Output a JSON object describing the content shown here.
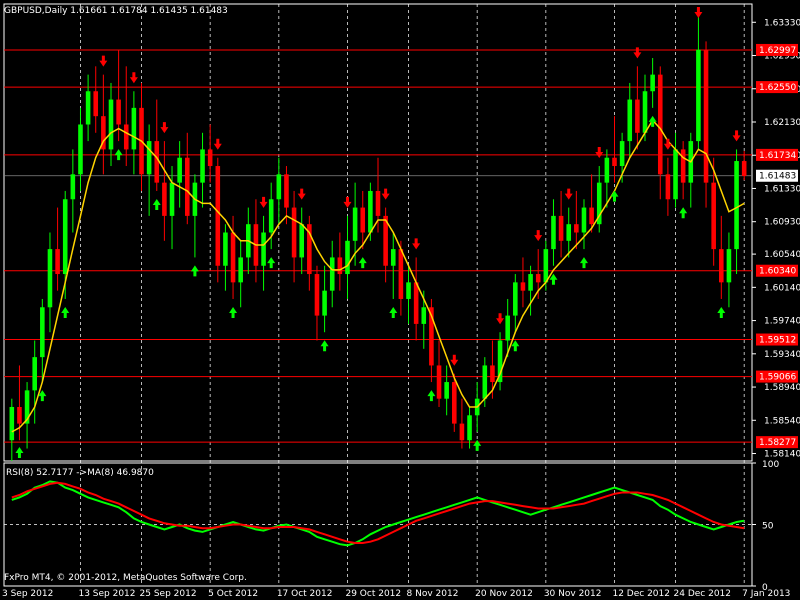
{
  "header": {
    "symbol_info": "GBPUSD,Daily  1.61661 1.61784 1.61435 1.61483"
  },
  "footer": {
    "copyright": "FxPro MT4, © 2001-2012, MetaQuotes Software Corp."
  },
  "colors": {
    "background": "#000000",
    "bull_candle": "#00ff00",
    "bear_candle": "#ff0000",
    "moving_average": "#ffd400",
    "level_line": "#ff0000",
    "up_arrow": "#00ff00",
    "down_arrow": "#ff0000",
    "rsi_line": "#00ff00",
    "rsi_ma_line": "#ff0000",
    "grid": "#ffffff"
  },
  "chart_data": [
    {
      "type": "candlestick",
      "symbol": "GBPUSD",
      "timeframe": "Daily",
      "ylim": [
        1.5805,
        1.6355
      ],
      "y_ticks": [
        "1.63330",
        "1.62930",
        "1.62530",
        "1.62130",
        "1.61730",
        "1.61330",
        "1.60930",
        "1.60540",
        "1.60140",
        "1.59740",
        "1.59340",
        "1.58940",
        "1.58540",
        "1.58140"
      ],
      "x_ticks": [
        "3 Sep 2012",
        "13 Sep 2012",
        "25 Sep 2012",
        "5 Oct 2012",
        "17 Oct 2012",
        "29 Oct 2012",
        "8 Nov 2012",
        "20 Nov 2012",
        "30 Nov 2012",
        "12 Dec 2012",
        "24 Dec 2012",
        "7 Jan 2013"
      ],
      "levels": [
        {
          "value": 1.62997,
          "label": "1.62997"
        },
        {
          "value": 1.6255,
          "label": "1.62550"
        },
        {
          "value": 1.61734,
          "label": "1.61734"
        },
        {
          "value": 1.6034,
          "label": "1.60340"
        },
        {
          "value": 1.59512,
          "label": "1.59512"
        },
        {
          "value": 1.59066,
          "label": "1.59066"
        },
        {
          "value": 1.58277,
          "label": "1.58277"
        }
      ],
      "current_price": {
        "value": 1.61483,
        "label": "1.61483"
      },
      "series": [
        {
          "name": "GBPUSD",
          "values": [
            [
              1.583,
              1.588,
              1.5805,
              1.587
            ],
            [
              1.587,
              1.592,
              1.583,
              1.585
            ],
            [
              1.585,
              1.59,
              1.582,
              1.589
            ],
            [
              1.589,
              1.595,
              1.585,
              1.593
            ],
            [
              1.593,
              1.6,
              1.59,
              1.599
            ],
            [
              1.599,
              1.608,
              1.596,
              1.606
            ],
            [
              1.606,
              1.611,
              1.601,
              1.603
            ],
            [
              1.603,
              1.613,
              1.6,
              1.612
            ],
            [
              1.612,
              1.618,
              1.608,
              1.615
            ],
            [
              1.615,
              1.623,
              1.613,
              1.621
            ],
            [
              1.621,
              1.627,
              1.619,
              1.625
            ],
            [
              1.625,
              1.628,
              1.62,
              1.622
            ],
            [
              1.622,
              1.627,
              1.615,
              1.618
            ],
            [
              1.618,
              1.626,
              1.616,
              1.624
            ],
            [
              1.624,
              1.63,
              1.619,
              1.621
            ],
            [
              1.621,
              1.628,
              1.616,
              1.618
            ],
            [
              1.618,
              1.625,
              1.615,
              1.623
            ],
            [
              1.623,
              1.626,
              1.613,
              1.615
            ],
            [
              1.615,
              1.621,
              1.61,
              1.619
            ],
            [
              1.619,
              1.624,
              1.613,
              1.614
            ],
            [
              1.614,
              1.619,
              1.607,
              1.61
            ],
            [
              1.61,
              1.616,
              1.606,
              1.614
            ],
            [
              1.614,
              1.619,
              1.611,
              1.617
            ],
            [
              1.617,
              1.62,
              1.609,
              1.61
            ],
            [
              1.61,
              1.615,
              1.605,
              1.614
            ],
            [
              1.614,
              1.62,
              1.611,
              1.618
            ],
            [
              1.618,
              1.621,
              1.614,
              1.616
            ],
            [
              1.616,
              1.617,
              1.602,
              1.604
            ],
            [
              1.604,
              1.609,
              1.601,
              1.608
            ],
            [
              1.608,
              1.61,
              1.6,
              1.602
            ],
            [
              1.602,
              1.607,
              1.599,
              1.605
            ],
            [
              1.605,
              1.611,
              1.603,
              1.609
            ],
            [
              1.609,
              1.612,
              1.602,
              1.604
            ],
            [
              1.604,
              1.61,
              1.601,
              1.608
            ],
            [
              1.608,
              1.614,
              1.606,
              1.612
            ],
            [
              1.612,
              1.617,
              1.609,
              1.615
            ],
            [
              1.615,
              1.616,
              1.609,
              1.611
            ],
            [
              1.611,
              1.613,
              1.602,
              1.605
            ],
            [
              1.605,
              1.611,
              1.603,
              1.609
            ],
            [
              1.609,
              1.61,
              1.601,
              1.603
            ],
            [
              1.603,
              1.604,
              1.595,
              1.598
            ],
            [
              1.598,
              1.604,
              1.596,
              1.601
            ],
            [
              1.601,
              1.607,
              1.599,
              1.605
            ],
            [
              1.605,
              1.608,
              1.601,
              1.603
            ],
            [
              1.603,
              1.61,
              1.6,
              1.607
            ],
            [
              1.607,
              1.614,
              1.604,
              1.611
            ],
            [
              1.611,
              1.613,
              1.606,
              1.608
            ],
            [
              1.608,
              1.614,
              1.607,
              1.613
            ],
            [
              1.613,
              1.617,
              1.608,
              1.61
            ],
            [
              1.61,
              1.611,
              1.602,
              1.604
            ],
            [
              1.604,
              1.608,
              1.6,
              1.606
            ],
            [
              1.606,
              1.607,
              1.598,
              1.6
            ],
            [
              1.6,
              1.604,
              1.597,
              1.602
            ],
            [
              1.602,
              1.605,
              1.595,
              1.597
            ],
            [
              1.597,
              1.601,
              1.594,
              1.599
            ],
            [
              1.599,
              1.6,
              1.59,
              1.592
            ],
            [
              1.592,
              1.595,
              1.587,
              1.588
            ],
            [
              1.588,
              1.592,
              1.586,
              1.59
            ],
            [
              1.59,
              1.591,
              1.584,
              1.585
            ],
            [
              1.585,
              1.588,
              1.582,
              1.583
            ],
            [
              1.583,
              1.587,
              1.582,
              1.586
            ],
            [
              1.586,
              1.59,
              1.584,
              1.588
            ],
            [
              1.588,
              1.593,
              1.587,
              1.592
            ],
            [
              1.592,
              1.595,
              1.588,
              1.59
            ],
            [
              1.59,
              1.596,
              1.589,
              1.595
            ],
            [
              1.595,
              1.6,
              1.593,
              1.598
            ],
            [
              1.598,
              1.603,
              1.596,
              1.602
            ],
            [
              1.602,
              1.605,
              1.599,
              1.601
            ],
            [
              1.601,
              1.604,
              1.598,
              1.603
            ],
            [
              1.603,
              1.606,
              1.6,
              1.602
            ],
            [
              1.602,
              1.607,
              1.601,
              1.606
            ],
            [
              1.606,
              1.612,
              1.604,
              1.61
            ],
            [
              1.61,
              1.613,
              1.605,
              1.607
            ],
            [
              1.607,
              1.611,
              1.605,
              1.609
            ],
            [
              1.609,
              1.613,
              1.606,
              1.608
            ],
            [
              1.608,
              1.612,
              1.606,
              1.611
            ],
            [
              1.611,
              1.615,
              1.608,
              1.609
            ],
            [
              1.609,
              1.616,
              1.608,
              1.614
            ],
            [
              1.614,
              1.618,
              1.611,
              1.617
            ],
            [
              1.617,
              1.622,
              1.614,
              1.616
            ],
            [
              1.616,
              1.62,
              1.614,
              1.619
            ],
            [
              1.619,
              1.626,
              1.617,
              1.624
            ],
            [
              1.624,
              1.628,
              1.618,
              1.62
            ],
            [
              1.62,
              1.627,
              1.619,
              1.625
            ],
            [
              1.625,
              1.629,
              1.623,
              1.627
            ],
            [
              1.627,
              1.628,
              1.612,
              1.615
            ],
            [
              1.615,
              1.617,
              1.61,
              1.612
            ],
            [
              1.612,
              1.62,
              1.611,
              1.618
            ],
            [
              1.618,
              1.619,
              1.612,
              1.614
            ],
            [
              1.614,
              1.62,
              1.611,
              1.619
            ],
            [
              1.619,
              1.634,
              1.618,
              1.63
            ],
            [
              1.63,
              1.631,
              1.611,
              1.614
            ],
            [
              1.614,
              1.617,
              1.604,
              1.606
            ],
            [
              1.606,
              1.61,
              1.6,
              1.602
            ],
            [
              1.602,
              1.608,
              1.599,
              1.606
            ],
            [
              1.606,
              1.618,
              1.603,
              1.6166
            ],
            [
              1.6166,
              1.6178,
              1.6143,
              1.6148
            ]
          ]
        }
      ],
      "moving_average": [
        1.584,
        1.5845,
        1.5855,
        1.587,
        1.59,
        1.594,
        1.598,
        1.602,
        1.606,
        1.61,
        1.614,
        1.617,
        1.619,
        1.62,
        1.6205,
        1.62,
        1.6195,
        1.619,
        1.618,
        1.617,
        1.6155,
        1.614,
        1.6135,
        1.613,
        1.612,
        1.6115,
        1.6115,
        1.6105,
        1.6095,
        1.608,
        1.607,
        1.607,
        1.6065,
        1.6065,
        1.6075,
        1.609,
        1.61,
        1.6095,
        1.609,
        1.608,
        1.606,
        1.6045,
        1.6035,
        1.6035,
        1.604,
        1.6055,
        1.6065,
        1.608,
        1.6095,
        1.6095,
        1.608,
        1.606,
        1.604,
        1.602,
        1.6,
        1.598,
        1.5955,
        1.593,
        1.5905,
        1.5885,
        1.587,
        1.587,
        1.588,
        1.589,
        1.591,
        1.5935,
        1.596,
        1.598,
        1.5995,
        1.601,
        1.602,
        1.6035,
        1.6045,
        1.6055,
        1.6065,
        1.6075,
        1.6085,
        1.61,
        1.6115,
        1.613,
        1.615,
        1.617,
        1.6185,
        1.62,
        1.6215,
        1.6205,
        1.619,
        1.618,
        1.617,
        1.6165,
        1.618,
        1.6175,
        1.6155,
        1.613,
        1.6105,
        1.611,
        1.6115
      ],
      "up_arrows_at": [
        1,
        4,
        7,
        14,
        19,
        24,
        29,
        34,
        41,
        46,
        50,
        55,
        61,
        66,
        71,
        75,
        79,
        84,
        88,
        93
      ],
      "down_arrows_at": [
        12,
        16,
        20,
        27,
        33,
        38,
        44,
        49,
        53,
        58,
        64,
        69,
        73,
        77,
        82,
        86,
        90,
        95
      ]
    },
    {
      "type": "line",
      "title": "RSI(8) 52.7177  ->MA(8) 46.9870",
      "ylim": [
        0,
        100
      ],
      "y_ticks": [
        "100",
        "50",
        "0"
      ],
      "series": [
        {
          "name": "RSI(8)",
          "values": [
            70,
            72,
            75,
            80,
            82,
            85,
            84,
            80,
            78,
            75,
            72,
            70,
            68,
            66,
            64,
            60,
            55,
            52,
            50,
            48,
            46,
            48,
            50,
            47,
            45,
            44,
            46,
            48,
            50,
            52,
            50,
            48,
            46,
            45,
            47,
            49,
            50,
            48,
            46,
            44,
            40,
            38,
            36,
            34,
            33,
            35,
            38,
            42,
            45,
            48,
            50,
            52,
            54,
            56,
            58,
            60,
            62,
            64,
            66,
            68,
            70,
            72,
            70,
            68,
            66,
            64,
            62,
            60,
            58,
            60,
            62,
            64,
            66,
            68,
            70,
            72,
            74,
            76,
            78,
            80,
            78,
            76,
            74,
            72,
            70,
            65,
            62,
            58,
            55,
            52,
            50,
            48,
            46,
            48,
            50,
            52,
            53
          ]
        },
        {
          "name": "MA(8)",
          "values": [
            72,
            74,
            77,
            79,
            81,
            83,
            84,
            83,
            81,
            79,
            76,
            74,
            71,
            69,
            67,
            64,
            61,
            58,
            55,
            53,
            51,
            50,
            49,
            49,
            48,
            47,
            47,
            48,
            49,
            50,
            50,
            49,
            48,
            47,
            47,
            48,
            48,
            48,
            47,
            46,
            44,
            42,
            40,
            38,
            36,
            35,
            35,
            36,
            38,
            41,
            44,
            47,
            50,
            53,
            55,
            57,
            59,
            61,
            63,
            65,
            67,
            68,
            69,
            69,
            68,
            67,
            66,
            65,
            64,
            63,
            63,
            63,
            64,
            65,
            66,
            67,
            69,
            71,
            73,
            75,
            76,
            76,
            76,
            75,
            74,
            72,
            70,
            67,
            64,
            61,
            58,
            55,
            52,
            50,
            49,
            48,
            47
          ]
        }
      ]
    }
  ]
}
